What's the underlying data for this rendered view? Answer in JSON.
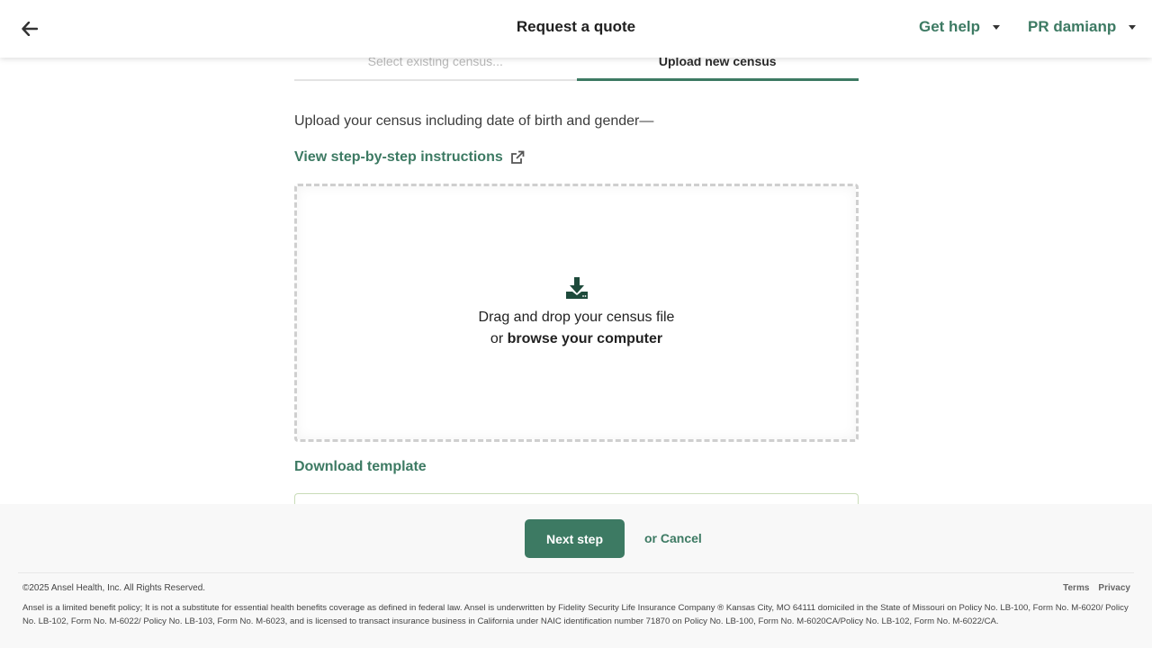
{
  "header": {
    "title": "Request a quote",
    "help_label": "Get help",
    "user_label": "PR damianp"
  },
  "tabs": [
    {
      "label": "Select existing census..."
    },
    {
      "label": "Upload new census"
    }
  ],
  "main": {
    "intro_text": "Upload your census including date of birth and gender—",
    "instructions_link": "View step-by-step instructions",
    "dropzone": {
      "line1": "Drag and drop your census file",
      "line2_prefix": "or ",
      "line2_action": "browse your computer"
    },
    "download_template": "Download template"
  },
  "actions": {
    "next_label": "Next step",
    "cancel_label": "or Cancel"
  },
  "footer": {
    "copyright": "©2025 Ansel Health, Inc. All Rights Reserved.",
    "terms": "Terms",
    "privacy": "Privacy",
    "disclaimer": "Ansel is a limited benefit policy; It is not a substitute for essential health benefits coverage as defined in federal law. Ansel is underwritten by Fidelity Security Life Insurance Company ® Kansas City, MO 64111 domiciled in the State of Missouri on Policy No. LB-100, Form No. M-6020/ Policy No. LB-102, Form No. M-6022/ Policy No. LB-103, Form No. M-6023, and is licensed to transact insurance business in California under NAIC identification number 71870 on Policy No. LB-100, Form No. M-6020CA/Policy No. LB-102, Form No. M-6022/CA."
  },
  "colors": {
    "accent": "#3d7a63",
    "text": "#1f1f1f",
    "footer_bg": "#f8f8f8",
    "dropzone_border": "#cfcfcf"
  },
  "icons": {
    "back": "arrow-left-icon",
    "external": "external-link-icon",
    "download": "download-tray-icon",
    "caret": "caret-down-icon"
  }
}
